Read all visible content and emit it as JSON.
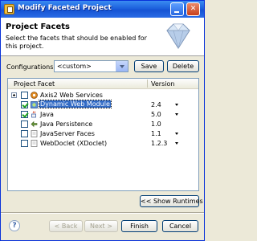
{
  "window": {
    "title": "Modify Faceted Project",
    "close_glyph": "✕"
  },
  "header": {
    "title": "Project Facets",
    "description": "Select the facets that should be enabled for this project.",
    "icon": "diamond-gem-icon"
  },
  "configurations": {
    "label": "Configurations:",
    "selected": "<custom>",
    "save_label": "Save",
    "delete_label": "Delete"
  },
  "facets": {
    "columns": {
      "facet": "Project Facet",
      "version": "Version"
    },
    "rows": [
      {
        "name": "Axis2 Web Services",
        "version": "",
        "checked": false,
        "expandable": true,
        "has_dropdown": false,
        "selected": false,
        "icon": "axis2-icon"
      },
      {
        "name": "Dynamic Web Module",
        "version": "2.4",
        "checked": true,
        "expandable": false,
        "has_dropdown": true,
        "selected": true,
        "icon": "web-module-icon"
      },
      {
        "name": "Java",
        "version": "5.0",
        "checked": true,
        "expandable": false,
        "has_dropdown": true,
        "selected": false,
        "icon": "java-icon"
      },
      {
        "name": "Java Persistence",
        "version": "1.0",
        "checked": false,
        "expandable": false,
        "has_dropdown": false,
        "selected": false,
        "icon": "persistence-icon"
      },
      {
        "name": "JavaServer Faces",
        "version": "1.1",
        "checked": false,
        "expandable": false,
        "has_dropdown": true,
        "selected": false,
        "icon": "jsf-icon"
      },
      {
        "name": "WebDoclet (XDoclet)",
        "version": "1.2.3",
        "checked": false,
        "expandable": false,
        "has_dropdown": true,
        "selected": false,
        "icon": "webdoclet-icon"
      }
    ]
  },
  "show_runtimes_label": "<< Show Runtimes",
  "footer": {
    "help_glyph": "?",
    "back_label": "< Back",
    "next_label": "Next >",
    "finish_label": "Finish",
    "cancel_label": "Cancel"
  },
  "colors": {
    "title_bar": "#1d61dd",
    "selection": "#316ac5",
    "check": "#21a121"
  }
}
